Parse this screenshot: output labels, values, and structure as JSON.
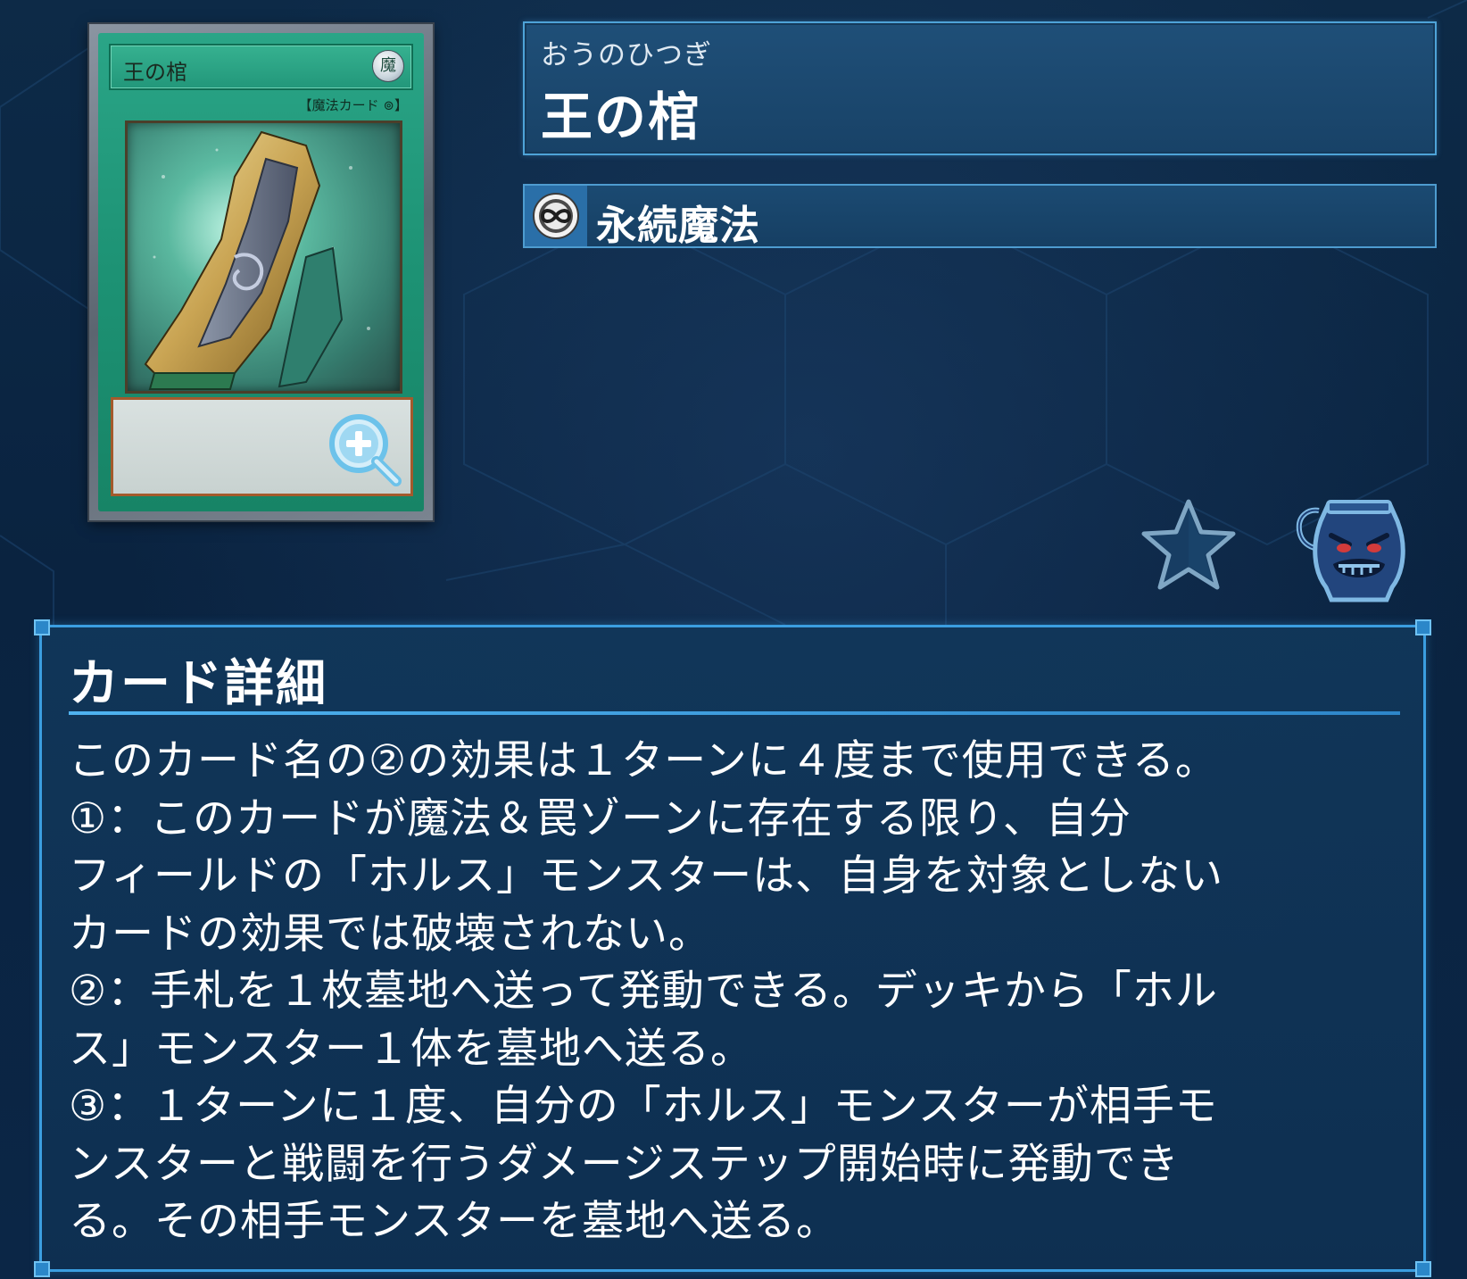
{
  "card": {
    "ruby": "おうのひつぎ",
    "name": "王の棺",
    "type_label": "永続魔法",
    "type_icon": "continuous-spell-icon",
    "image": {
      "name_text": "王の棺",
      "attribute": "魔",
      "type_line": "【魔法カード ⊚】"
    }
  },
  "actions": {
    "favorite_icon": "star-icon",
    "collection_icon": "pot-of-greed-icon",
    "zoom_icon": "zoom-in-icon"
  },
  "details": {
    "heading": "カード詳細",
    "lines": [
      "このカード名の②の効果は１ターンに４度まで使用できる。",
      "①：このカードが魔法＆罠ゾーンに存在する限り、自分",
      "フィールドの「ホルス」モンスターは、自身を対象としない",
      "カードの効果では破壊されない。",
      "②：手札を１枚墓地へ送って発動できる。デッキから「ホル",
      "ス」モンスター１体を墓地へ送る。",
      "③：１ターンに１度、自分の「ホルス」モンスターが相手モ",
      "ンスターと戦闘を行うダメージステップ開始時に発動でき",
      "る。その相手モンスターを墓地へ送る。"
    ]
  },
  "colors": {
    "background": "#0b2646",
    "panel_border": "#3b9ee0",
    "spell_card_green": "#1d9274"
  }
}
